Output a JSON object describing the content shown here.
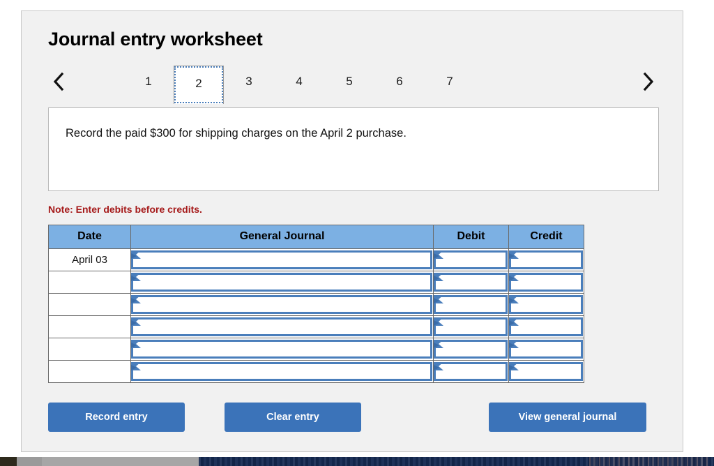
{
  "worksheet": {
    "title": "Journal entry worksheet",
    "nav": {
      "prev_label": "‹",
      "next_label": "›",
      "prev_name": "previous-page",
      "next_name": "next-page"
    },
    "tabs": [
      {
        "label": "1",
        "active": false
      },
      {
        "label": "2",
        "active": true
      },
      {
        "label": "3",
        "active": false
      },
      {
        "label": "4",
        "active": false
      },
      {
        "label": "5",
        "active": false
      },
      {
        "label": "6",
        "active": false
      },
      {
        "label": "7",
        "active": false
      }
    ],
    "instruction": "Record the paid $300 for shipping charges on the April 2 purchase.",
    "note": "Note: Enter debits before credits."
  },
  "table": {
    "headers": [
      "Date",
      "General Journal",
      "Debit",
      "Credit"
    ],
    "rows": [
      {
        "date": "April 03",
        "journal": "",
        "debit": "",
        "credit": ""
      },
      {
        "date": "",
        "journal": "",
        "debit": "",
        "credit": ""
      },
      {
        "date": "",
        "journal": "",
        "debit": "",
        "credit": ""
      },
      {
        "date": "",
        "journal": "",
        "debit": "",
        "credit": ""
      },
      {
        "date": "",
        "journal": "",
        "debit": "",
        "credit": ""
      },
      {
        "date": "",
        "journal": "",
        "debit": "",
        "credit": ""
      }
    ]
  },
  "buttons": {
    "record": "Record entry",
    "clear": "Clear entry",
    "view": "View general journal"
  },
  "colors": {
    "header_blue": "#7cb0e3",
    "button_blue": "#3b73b9",
    "field_blue": "#4a7ebb",
    "note_red": "#a51919",
    "card_bg": "#f1f1f1"
  }
}
